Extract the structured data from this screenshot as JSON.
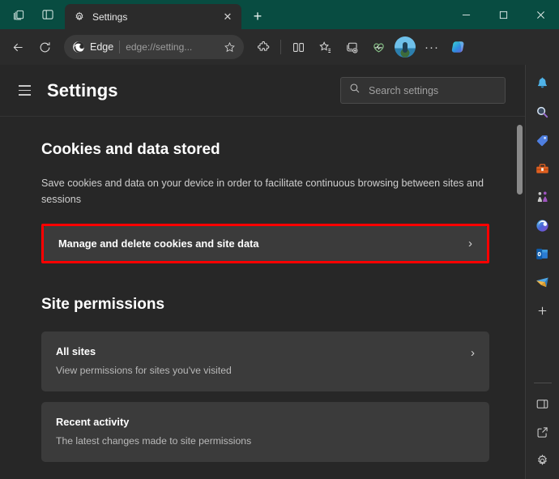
{
  "titlebar": {
    "workspaces_icon": "workspaces-icon",
    "tab_actions_icon": "tab-actions-icon",
    "tab": {
      "favicon": "gear-icon",
      "title": "Settings",
      "close_label": "✕"
    },
    "new_tab_label": "+",
    "window_controls": {
      "minimize": "—",
      "maximize": "☐",
      "close": "✕"
    },
    "background_color": "#084c41"
  },
  "toolbar": {
    "back_label": "←",
    "refresh_label": "↻",
    "address": {
      "site_label": "Edge",
      "url_text": "edge://setting...",
      "favorite_icon": "star-icon"
    },
    "extensions_icon": "extensions-icon",
    "split_screen_icon": "split-screen-icon",
    "favorites_icon": "favorites-icon",
    "collections_icon": "collections-icon",
    "browser_essentials_icon": "browser-essentials-icon",
    "profile_icon": "profile-avatar",
    "more_label": "···",
    "copilot_icon": "copilot-icon",
    "background_color": "#2b2b2b"
  },
  "settings_header": {
    "menu_icon": "hamburger-menu-icon",
    "title": "Settings",
    "search": {
      "icon": "search-icon",
      "placeholder": "Search settings",
      "value": ""
    }
  },
  "content": {
    "sections": [
      {
        "title": "Cookies and data stored",
        "description": "Save cookies and data on your device in order to facilitate continuous browsing between sites and sessions",
        "highlighted_card": {
          "title": "Manage and delete cookies and site data",
          "chevron": "›",
          "highlight_color": "#ff0000"
        }
      },
      {
        "title": "Site permissions",
        "cards": [
          {
            "title": "All sites",
            "subtitle": "View permissions for sites you've visited",
            "chevron": "›"
          },
          {
            "title": "Recent activity",
            "subtitle": "The latest changes made to site permissions",
            "chevron": ""
          }
        ]
      }
    ],
    "background_color": "#272727",
    "card_color": "#3b3b3b"
  },
  "rail": {
    "items": [
      {
        "icon": "notifications-bell-icon"
      },
      {
        "icon": "search-icon"
      },
      {
        "icon": "shopping-tag-icon"
      },
      {
        "icon": "tools-toolbox-icon"
      },
      {
        "icon": "games-icon"
      },
      {
        "icon": "copilot-icon"
      },
      {
        "icon": "outlook-icon"
      },
      {
        "icon": "paper-plane-icon"
      },
      {
        "icon": "add-sidebar-app-icon",
        "label": "+"
      }
    ],
    "bottom_items": [
      {
        "icon": "toggle-sidebar-icon"
      },
      {
        "icon": "open-in-new-window-icon"
      },
      {
        "icon": "sidebar-settings-gear-icon"
      }
    ]
  }
}
